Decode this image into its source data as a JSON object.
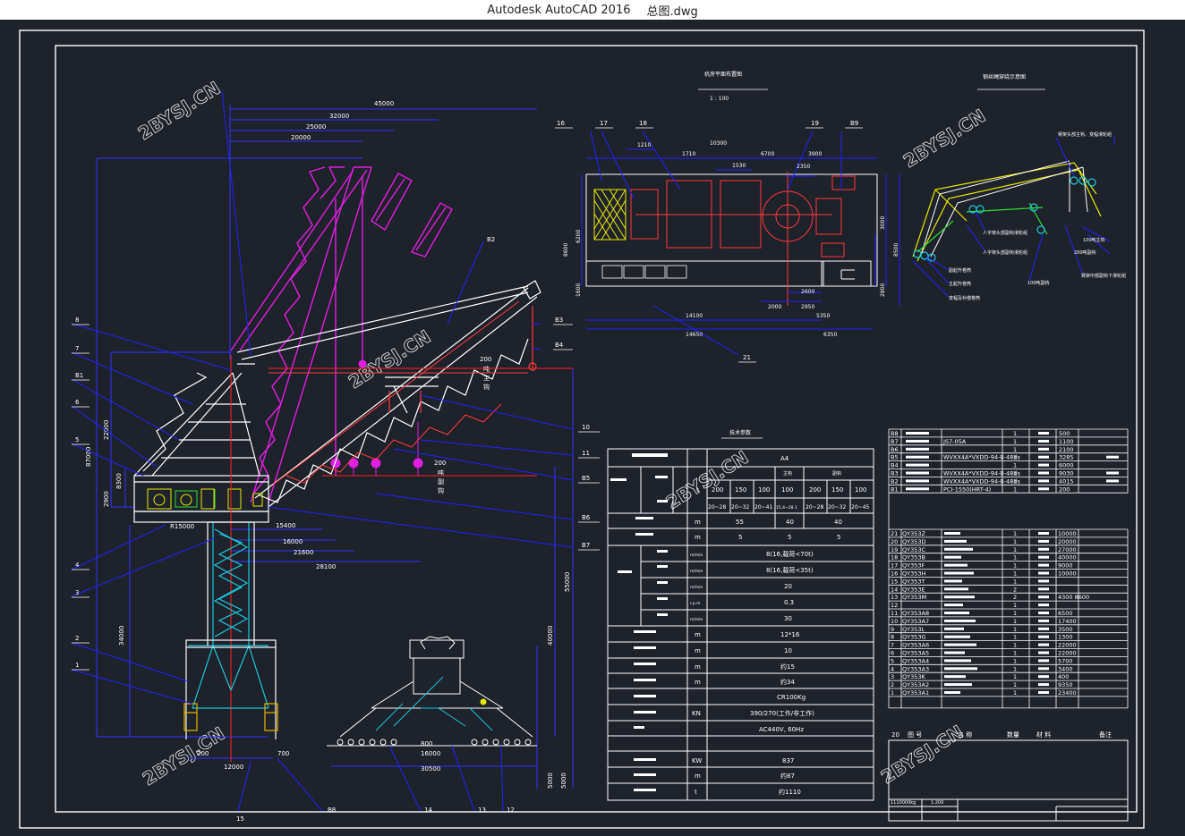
{
  "window": {
    "app_title": "Autodesk AutoCAD 2016",
    "file_name": "总图.dwg"
  },
  "watermark": "2BYSJ.CN",
  "dimensions": {
    "top": [
      "45000",
      "32000",
      "25000",
      "20000"
    ],
    "left": [
      "87000",
      "22000",
      "8300",
      "2900",
      "34000"
    ],
    "right": [
      "55000",
      "40000",
      "5000"
    ],
    "horizontal": [
      "R15000",
      "15400",
      "16000",
      "21600",
      "28100"
    ],
    "bottom": [
      "200",
      "12000",
      "700",
      "800",
      "16000",
      "30500"
    ]
  },
  "callouts": {
    "left": [
      "8",
      "7",
      "B1",
      "6",
      "5",
      "4",
      "3",
      "2",
      "1"
    ],
    "right": [
      "B3",
      "B4",
      "10",
      "11",
      "B5",
      "B6",
      "B7"
    ],
    "top": [
      "16",
      "17",
      "18",
      "19",
      "B9",
      "B2"
    ],
    "bottom": [
      "15",
      "B8",
      "14",
      "13",
      "12"
    ],
    "mid": [
      "21"
    ]
  },
  "hook_labels": {
    "upper": [
      "200",
      "吨",
      "主",
      "钩"
    ],
    "lower": [
      "200",
      "吨",
      "副",
      "钩"
    ]
  },
  "plan": {
    "title": "机房平面布置图",
    "scale": "1 : 100",
    "dims": [
      "1210",
      "1710",
      "10300",
      "6700",
      "3900",
      "1530",
      "2350",
      "14100",
      "14650",
      "6350",
      "2000",
      "2950",
      "2600",
      "5350",
      "6200",
      "8600",
      "1600",
      "3000",
      "8500",
      "2800"
    ]
  },
  "rope_diagram": {
    "title": "钢丝绳穿绕示意图",
    "labels": [
      "臂架头部主钩、变幅滑轮组",
      "100吨主钩",
      "人字架头部副钩滑轮组",
      "200吨副钩",
      "副起升卷筒",
      "主起升卷筒",
      "臂架中部副钩下滑轮组",
      "100吨副钩",
      "变幅及补偿卷筒"
    ]
  },
  "tech": {
    "title": "技术参数",
    "header": {
      "a4": "A4",
      "main_hook": "主钩",
      "aux_hook": "副钩",
      "col_t": "t"
    },
    "loads_main": [
      "200",
      "150",
      "100"
    ],
    "loads_main2": [
      "100"
    ],
    "loads_aux": [
      "200",
      "150",
      "100"
    ],
    "radius_main": [
      "20~28",
      "20~32",
      "20~41"
    ],
    "radius_main2": "15.4~28.1",
    "radius_aux": [
      "20~28",
      "20~32",
      "20~45"
    ],
    "unit_m": "m",
    "lift_height": [
      "55",
      "40",
      "40"
    ],
    "depth": [
      "5",
      "5",
      "5"
    ],
    "speed_unit": "m/min",
    "speeds": [
      "8(16,载荷<70t)",
      "8(16,载荷<35t)",
      "20",
      "0.3",
      "30"
    ],
    "speed_units": [
      "m/min",
      "m/min",
      "m/min",
      "r.p.m",
      "m/min"
    ],
    "rows": [
      {
        "unit": "m",
        "value": "12*16"
      },
      {
        "unit": "m",
        "value": "10"
      },
      {
        "unit": "m",
        "value": "约15"
      },
      {
        "unit": "m",
        "value": "约34"
      },
      {
        "unit": "",
        "value": "CR100Kg"
      },
      {
        "unit": "KN",
        "value": "390/270(工作/非工作)"
      },
      {
        "unit": "",
        "value": "AC440V, 60Hz"
      },
      {
        "unit": "",
        "value": ""
      },
      {
        "unit": "KW",
        "value": "837"
      },
      {
        "unit": "m",
        "value": "约87"
      },
      {
        "unit": "t",
        "value": "约1110"
      }
    ]
  },
  "parts": {
    "b_rows": [
      {
        "id": "B8",
        "code": "",
        "qty": "1",
        "w": "500"
      },
      {
        "id": "B7",
        "code": "JS7-05A",
        "qty": "1",
        "w": "1100"
      },
      {
        "id": "B6",
        "code": "",
        "qty": "1",
        "w": "2100"
      },
      {
        "id": "B5",
        "code": "WVXX4A*VXDD-94-B-48ds",
        "qty": "1",
        "w": "3285"
      },
      {
        "id": "B4",
        "code": "",
        "qty": "1",
        "w": "6000"
      },
      {
        "id": "B3",
        "code": "WVXX4A*VXDD-94-B-48ds",
        "qty": "1",
        "w": "9030"
      },
      {
        "id": "B2",
        "code": "WVXX4A*VXDD-94-B-48ds",
        "qty": "1",
        "w": "4015"
      },
      {
        "id": "B1",
        "code": "PCI-1550(HRT-4)",
        "qty": "1",
        "w": "200"
      }
    ],
    "rows": [
      {
        "id": "21",
        "code": "QY353Z",
        "qty": "1",
        "w": "10000"
      },
      {
        "id": "20",
        "code": "QY353D",
        "qty": "1",
        "w": "20000"
      },
      {
        "id": "19",
        "code": "QY353C",
        "qty": "1",
        "w": "27000"
      },
      {
        "id": "18",
        "code": "QY353B",
        "qty": "1",
        "w": "40000"
      },
      {
        "id": "17",
        "code": "QY353F",
        "qty": "1",
        "w": "9000"
      },
      {
        "id": "16",
        "code": "QY353H",
        "qty": "1",
        "w": "10000"
      },
      {
        "id": "15",
        "code": "QY353T",
        "qty": "1",
        "w": ""
      },
      {
        "id": "14",
        "code": "QY353E",
        "qty": "2",
        "w": ""
      },
      {
        "id": "13",
        "code": "QY353M",
        "qty": "2",
        "w": "4300 8600"
      },
      {
        "id": "12",
        "code": "",
        "qty": "1",
        "w": ""
      },
      {
        "id": "11",
        "code": "QY353A8",
        "qty": "1",
        "w": "6500"
      },
      {
        "id": "10",
        "code": "QY353A7",
        "qty": "1",
        "w": "17400"
      },
      {
        "id": "9",
        "code": "QY353L",
        "qty": "1",
        "w": "3500"
      },
      {
        "id": "8",
        "code": "QY353G",
        "qty": "1",
        "w": "1300"
      },
      {
        "id": "7",
        "code": "QY353A6",
        "qty": "1",
        "w": "22000"
      },
      {
        "id": "6",
        "code": "QY353A5",
        "qty": "1",
        "w": "22000"
      },
      {
        "id": "5",
        "code": "QY353A4",
        "qty": "1",
        "w": "5700"
      },
      {
        "id": "4",
        "code": "QY353A3",
        "qty": "1",
        "w": "3400"
      },
      {
        "id": "3",
        "code": "QY353K",
        "qty": "1",
        "w": "400"
      },
      {
        "id": "2",
        "code": "QY353A2",
        "qty": "1",
        "w": "9350"
      },
      {
        "id": "1",
        "code": "QY353A1",
        "qty": "1",
        "w": "23400"
      }
    ],
    "header": {
      "no": "20",
      "code": "图 号",
      "name": "名 称",
      "qty": "数量",
      "mat": "材 料",
      "note": "备注"
    },
    "title_block": {
      "weight": "1110000kg",
      "scale": "1:200"
    }
  },
  "colors": {
    "bg": "#1e222b",
    "frame": "#ffffff",
    "blue": "#2222ff",
    "magenta": "#e01fe0",
    "cyan": "#1cc8d8",
    "red": "#ff2222",
    "yellow": "#e8e800",
    "green": "#33dd33"
  }
}
